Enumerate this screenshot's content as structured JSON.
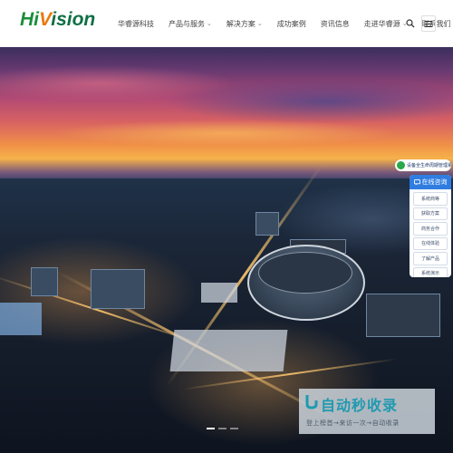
{
  "header": {
    "logo_text": "HiVision",
    "logo_parts": {
      "a": "Hi",
      "b": "V",
      "c": "ision"
    },
    "nav": [
      {
        "label": "华睿源科技",
        "has_dropdown": false
      },
      {
        "label": "产品与服务",
        "has_dropdown": true
      },
      {
        "label": "解决方案",
        "has_dropdown": true
      },
      {
        "label": "成功案例",
        "has_dropdown": false
      },
      {
        "label": "资讯信息",
        "has_dropdown": false
      },
      {
        "label": "走进华睿源",
        "has_dropdown": true
      },
      {
        "label": "联系我们",
        "has_dropdown": false
      }
    ],
    "icons": {
      "search": "search-icon",
      "menu": "menu-icon"
    }
  },
  "side_widget": {
    "top_label": "设备全生命周期管理系统",
    "head_label": "在线咨询",
    "items": [
      "系统商等",
      "获取方案",
      "商务合作",
      "在线体验",
      "了解产品",
      "系统演示"
    ]
  },
  "watermark": {
    "title": "自动秒收录",
    "subtitle": "登上榜首→来访一次→自动收录"
  },
  "colors": {
    "brand_green": "#1a8f3a",
    "brand_orange": "#e87a10",
    "accent_blue": "#2f7de1"
  },
  "slider": {
    "count": 3,
    "active": 0
  }
}
